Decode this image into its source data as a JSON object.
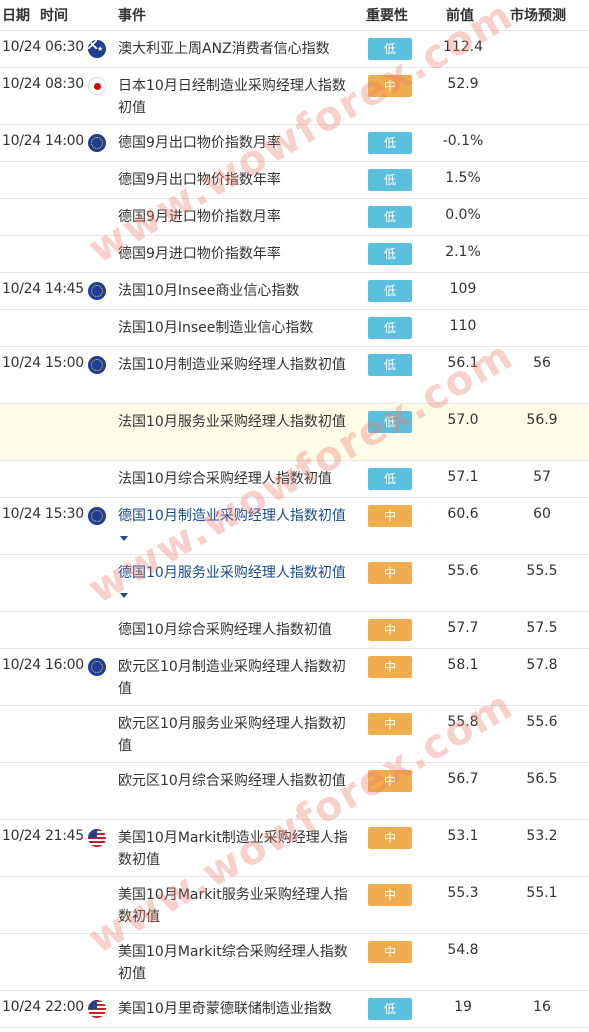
{
  "header": {
    "date": "日期",
    "time": "时间",
    "event": "事件",
    "importance": "重要性",
    "previous": "前值",
    "forecast": "市场预测"
  },
  "rows": [
    {
      "datetime": "10/24 06:30",
      "flag": "australia-flag",
      "event": "澳大利亚上周ANZ消费者信心指数",
      "importance": "低",
      "previous": "112.4",
      "forecast": ""
    },
    {
      "datetime": "10/24 08:30",
      "flag": "japan-flag",
      "event": "日本10月日经制造业采购经理人指数初值",
      "importance": "中",
      "previous": "52.9",
      "forecast": ""
    },
    {
      "datetime": "10/24 14:00",
      "flag": "eu-flag",
      "event": "德国9月出口物价指数月率",
      "importance": "低",
      "previous": "-0.1%",
      "forecast": ""
    },
    {
      "datetime": "",
      "flag": "",
      "event": "德国9月出口物价指数年率",
      "importance": "低",
      "previous": "1.5%",
      "forecast": ""
    },
    {
      "datetime": "",
      "flag": "",
      "event": "德国9月进口物价指数月率",
      "importance": "低",
      "previous": "0.0%",
      "forecast": ""
    },
    {
      "datetime": "",
      "flag": "",
      "event": "德国9月进口物价指数年率",
      "importance": "低",
      "previous": "2.1%",
      "forecast": ""
    },
    {
      "datetime": "10/24 14:45",
      "flag": "eu-flag",
      "event": "法国10月Insee商业信心指数",
      "importance": "低",
      "previous": "109",
      "forecast": ""
    },
    {
      "datetime": "",
      "flag": "",
      "event": "法国10月Insee制造业信心指数",
      "importance": "低",
      "previous": "110",
      "forecast": ""
    },
    {
      "datetime": "10/24 15:00",
      "flag": "eu-flag",
      "event": "法国10月制造业采购经理人指数初值",
      "importance": "低",
      "previous": "56.1",
      "forecast": "56"
    },
    {
      "datetime": "",
      "flag": "",
      "event": "法国10月服务业采购经理人指数初值",
      "importance": "低",
      "previous": "57.0",
      "forecast": "56.9"
    },
    {
      "datetime": "",
      "flag": "",
      "event": "法国10月综合采购经理人指数初值",
      "importance": "低",
      "previous": "57.1",
      "forecast": "57"
    },
    {
      "datetime": "10/24 15:30",
      "flag": "eu-flag",
      "event": "德国10月制造业采购经理人指数初值",
      "importance": "中",
      "previous": "60.6",
      "forecast": "60"
    },
    {
      "datetime": "",
      "flag": "",
      "event": "德国10月服务业采购经理人指数初值",
      "importance": "中",
      "previous": "55.6",
      "forecast": "55.5"
    },
    {
      "datetime": "",
      "flag": "",
      "event": "德国10月综合采购经理人指数初值",
      "importance": "中",
      "previous": "57.7",
      "forecast": "57.5"
    },
    {
      "datetime": "10/24 16:00",
      "flag": "eu-flag",
      "event": "欧元区10月制造业采购经理人指数初值",
      "importance": "中",
      "previous": "58.1",
      "forecast": "57.8"
    },
    {
      "datetime": "",
      "flag": "",
      "event": "欧元区10月服务业采购经理人指数初值",
      "importance": "中",
      "previous": "55.8",
      "forecast": "55.6"
    },
    {
      "datetime": "",
      "flag": "",
      "event": "欧元区10月综合采购经理人指数初值",
      "importance": "中",
      "previous": "56.7",
      "forecast": "56.5"
    },
    {
      "datetime": "10/24 21:45",
      "flag": "us-flag",
      "event": "美国10月Markit制造业采购经理人指数初值",
      "importance": "中",
      "previous": "53.1",
      "forecast": "53.2"
    },
    {
      "datetime": "",
      "flag": "",
      "event": "美国10月Markit服务业采购经理人指数初值",
      "importance": "中",
      "previous": "55.3",
      "forecast": "55.1"
    },
    {
      "datetime": "",
      "flag": "",
      "event": "美国10月Markit综合采购经理人指数初值",
      "importance": "中",
      "previous": "54.8",
      "forecast": ""
    },
    {
      "datetime": "10/24 22:00",
      "flag": "us-flag",
      "event": "美国10月里奇蒙德联储制造业指数",
      "importance": "低",
      "previous": "19",
      "forecast": "16"
    }
  ],
  "watermark": "www.wowforex.com",
  "colors": {
    "low": "#5bc0de",
    "mid": "#f0ad4e",
    "link": "#1a4b8c",
    "highlight": "#fffde8"
  }
}
